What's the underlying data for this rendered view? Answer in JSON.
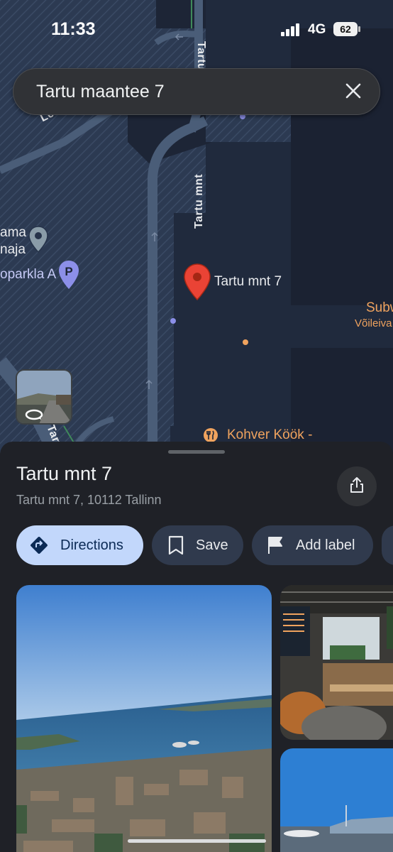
{
  "status_bar": {
    "time": "11:33",
    "network": "4G",
    "battery": "62"
  },
  "search": {
    "query": "Tartu maantee 7"
  },
  "map": {
    "road_labels": [
      "Lennujaama",
      "Tartu",
      "Tartu mnt",
      "Tartu"
    ],
    "poi_labels": {
      "partial_ama": "ama",
      "partial_naja": "naja",
      "parkla": "oparkla A",
      "pin_label": "Tartu mnt 7",
      "subway": "Subw",
      "subway_sub": "Võileiva",
      "kohver": "Kohver Köök -"
    },
    "colors": {
      "water_land": "#26334a",
      "building": "#202a3d",
      "road": "#4a5d78",
      "pin": "#ea4335"
    }
  },
  "sheet": {
    "title": "Tartu mnt 7",
    "address": "Tartu mnt 7, 10112 Tallinn",
    "actions": {
      "directions": "Directions",
      "save": "Save",
      "add_label": "Add label"
    }
  },
  "icons": [
    "close-icon",
    "share-icon",
    "directions-icon",
    "bookmark-icon",
    "flag-icon",
    "map-pin-icon",
    "parking-icon",
    "street-view-icon"
  ]
}
